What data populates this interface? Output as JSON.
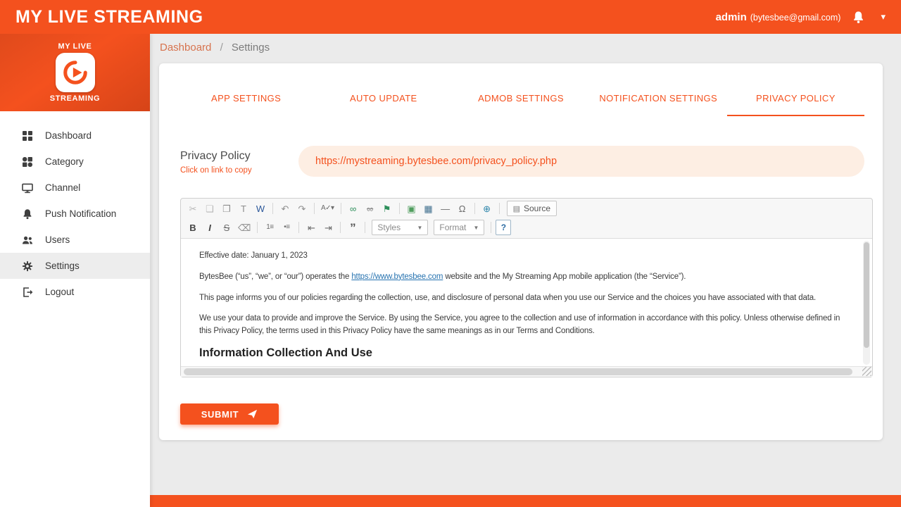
{
  "colors": {
    "primary": "#f4511e",
    "pill_bg": "#fdeee3",
    "link_blue": "#2773b0"
  },
  "icons": {
    "caret_down": "▾",
    "dd_caret": "▼"
  },
  "topbar": {
    "title": "MY LIVE STREAMING",
    "username": "admin",
    "email": "(bytesbee@gmail.com)"
  },
  "sidebar": {
    "logo_top": "MY LIVE",
    "logo_bottom": "STREAMING",
    "items": [
      {
        "label": "Dashboard"
      },
      {
        "label": "Category"
      },
      {
        "label": "Channel"
      },
      {
        "label": "Push Notification"
      },
      {
        "label": "Users"
      },
      {
        "label": "Settings"
      },
      {
        "label": "Logout"
      }
    ]
  },
  "breadcrumb": {
    "home": "Dashboard",
    "separator": "/",
    "current": "Settings"
  },
  "tabs": [
    {
      "label": "APP SETTINGS"
    },
    {
      "label": "AUTO UPDATE"
    },
    {
      "label": "ADMOB SETTINGS"
    },
    {
      "label": "NOTIFICATION SETTINGS"
    },
    {
      "label": "PRIVACY POLICY"
    }
  ],
  "privacy_field": {
    "label": "Privacy Policy",
    "hint": "Click on link to copy",
    "url": "https://mystreaming.bytesbee.com/privacy_policy.php"
  },
  "editor": {
    "toolbar1": [
      {
        "g": "✂"
      },
      {
        "g": "❏"
      },
      {
        "g": "❐"
      },
      {
        "g": "T"
      },
      {
        "g": "W"
      },
      {
        "g": "↶"
      },
      {
        "g": "↷"
      },
      {
        "g": "A✓▾"
      },
      {
        "g": "∞"
      },
      {
        "g": "∞"
      },
      {
        "g": "⚑"
      },
      {
        "g": "▣"
      },
      {
        "g": "▦"
      },
      {
        "g": "―"
      },
      {
        "g": "Ω"
      },
      {
        "g": "⊕"
      }
    ],
    "source": {
      "icon": "▤",
      "label": "Source"
    },
    "toolbar2": [
      {
        "g": "B"
      },
      {
        "g": "I"
      },
      {
        "g": "S"
      },
      {
        "g": "⌫"
      },
      {
        "g": "1≡"
      },
      {
        "g": "•≡"
      },
      {
        "g": "⇤"
      },
      {
        "g": "⇥"
      },
      {
        "g": "”"
      },
      {
        "g": "?"
      }
    ],
    "styles_label": "Styles",
    "format_label": "Format",
    "content": {
      "p1": "Effective date: January 1, 2023",
      "p2_before": "BytesBee (“us”, “we”, or “our”) operates the ",
      "p2_link": "https://www.bytesbee.com",
      "p2_after": " website and the My Streaming App mobile application (the “Service”).",
      "p3": "This page informs you of our policies regarding the collection, use, and disclosure of personal data when you use our Service and the choices you have associated with that data.",
      "p4": "We use your data to provide and improve the Service. By using the Service, you agree to the collection and use of information in accordance with this policy. Unless otherwise defined in this Privacy Policy, the terms used in this Privacy Policy have the same meanings as in our Terms and Conditions.",
      "heading": "Information Collection And Use"
    }
  },
  "submit_label": "SUBMIT"
}
